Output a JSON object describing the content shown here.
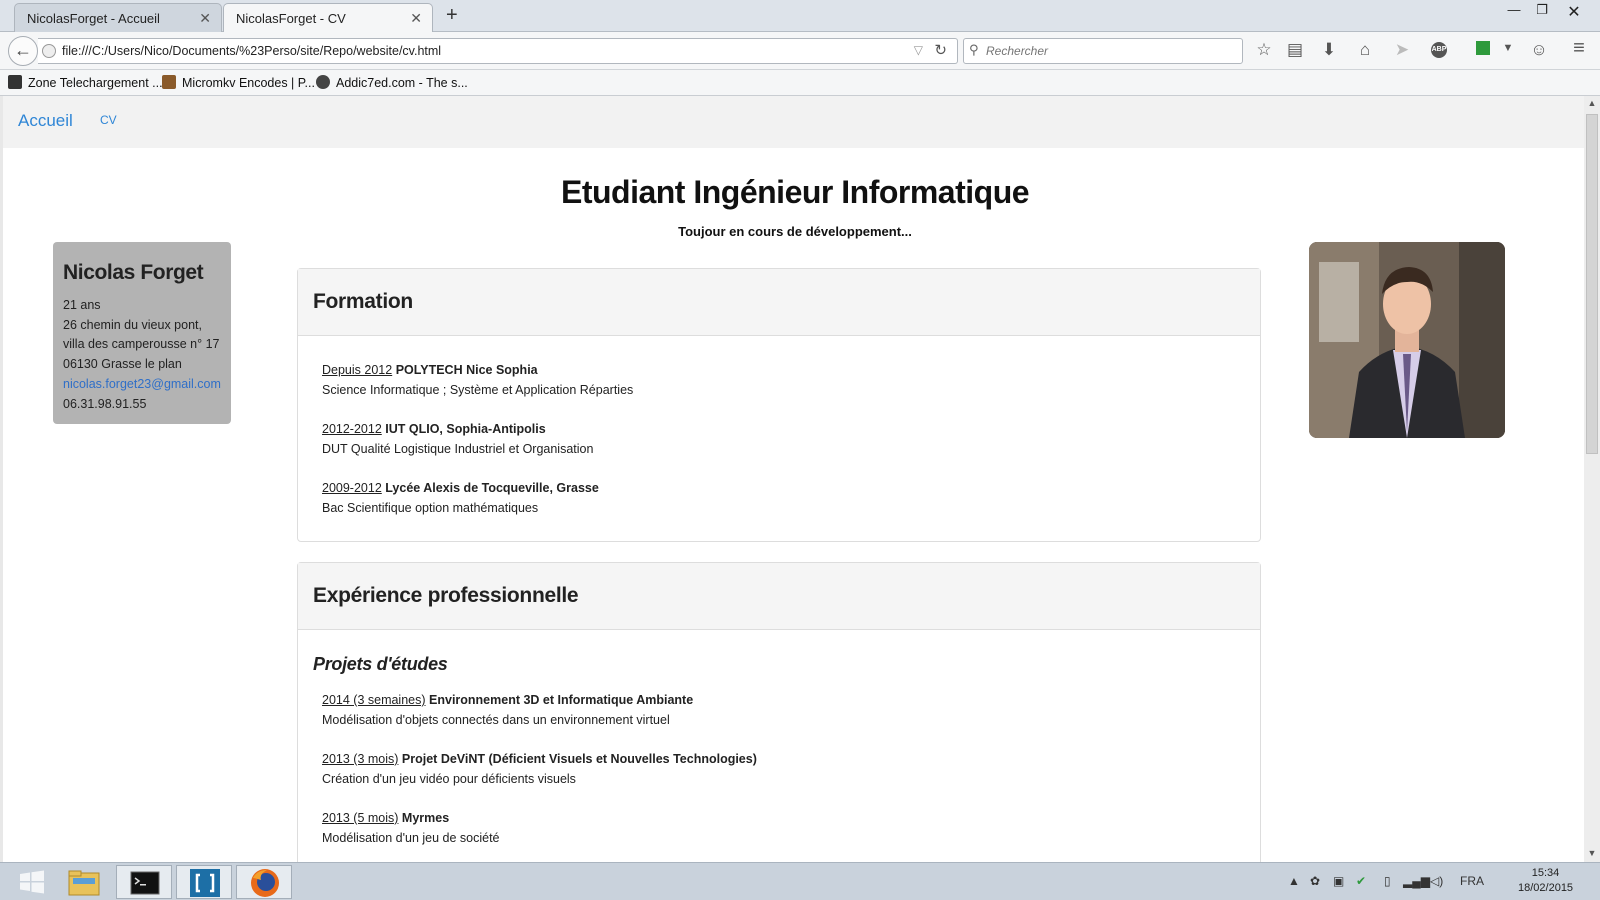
{
  "browser": {
    "tabs": [
      {
        "label": "NicolasForget - Accueil",
        "active": false
      },
      {
        "label": "NicolasForget - CV",
        "active": true
      }
    ],
    "url": "file:///C:/Users/Nico/Documents/%23Perso/site/Repo/website/cv.html",
    "search_placeholder": "Rechercher",
    "bookmarks": [
      {
        "label": "Zone Telechargement ...",
        "icon": "zt-icon"
      },
      {
        "label": "Micromkv Encodes | P...",
        "icon": "micromkv-icon"
      },
      {
        "label": "Addic7ed.com - The s...",
        "icon": "addic7ed-icon"
      }
    ]
  },
  "site": {
    "nav": {
      "brand": "Accueil",
      "link": "CV"
    },
    "title": "Etudiant Ingénieur Informatique",
    "subtitle": "Toujour en cours de développement..."
  },
  "profile": {
    "name": "Nicolas Forget",
    "age": "21 ans",
    "address1": "26 chemin du vieux pont,",
    "address2": "villa des camperousse n° 17",
    "address3": "06130 Grasse le plan",
    "email": "nicolas.forget23@gmail.com",
    "phone": "06.31.98.91.55"
  },
  "formation": {
    "heading": "Formation",
    "entries": [
      {
        "date": "Depuis 2012",
        "title": "POLYTECH Nice Sophia",
        "desc": "Science Informatique ; Système et Application Réparties"
      },
      {
        "date": "2012-2012",
        "title": "IUT QLIO, Sophia-Antipolis",
        "desc": "DUT Qualité Logistique Industriel et Organisation"
      },
      {
        "date": "2009-2012",
        "title": "Lycée Alexis de Tocqueville, Grasse",
        "desc": "Bac Scientifique option mathématiques"
      }
    ]
  },
  "experience": {
    "heading": "Expérience professionnelle",
    "subheading": "Projets d'études",
    "entries": [
      {
        "date": "2014 (3 semaines)",
        "title": "Environnement 3D et Informatique Ambiante",
        "desc": "Modélisation d'objets connectés dans un environnement virtuel"
      },
      {
        "date": "2013 (3 mois)",
        "title": "Projet DeViNT (Déficient Visuels et Nouvelles Technologies)",
        "desc": "Création d'un jeu vidéo pour déficients visuels"
      },
      {
        "date": "2013 (5 mois)",
        "title": "Myrmes",
        "desc": "Modélisation d'un jeu de société"
      }
    ]
  },
  "taskbar": {
    "lang": "FRA",
    "time": "15:34",
    "date": "18/02/2015"
  }
}
